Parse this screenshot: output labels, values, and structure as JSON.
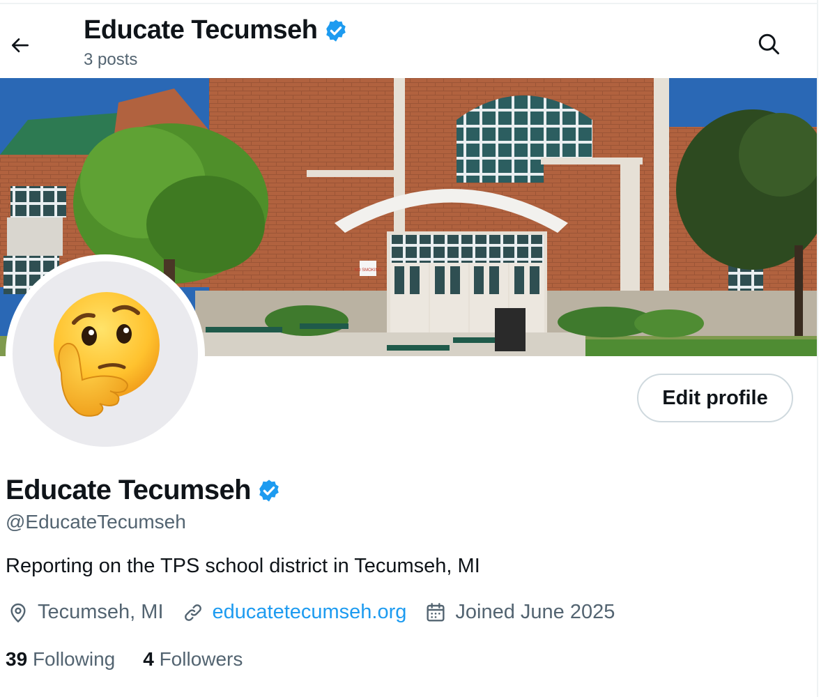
{
  "header": {
    "title": "Educate Tecumseh",
    "posts_count": "3 posts",
    "back_icon": "arrow-left-icon",
    "search_icon": "search-icon"
  },
  "profile": {
    "name": "Educate Tecumseh",
    "handle": "@EducateTecumseh",
    "bio": "Reporting on the TPS school district in Tecumseh, MI",
    "location": "Tecumseh, MI",
    "website": "educatetecumseh.org",
    "joined": "Joined June 2025",
    "following_count": "39",
    "following_label": "Following",
    "followers_count": "4",
    "followers_label": "Followers",
    "avatar_icon": "thinking-face-emoji",
    "verified_icon": "verified-badge-icon"
  },
  "actions": {
    "edit_profile_label": "Edit profile"
  },
  "banner": {
    "sign_text": "NO SMOKING"
  },
  "colors": {
    "accent": "#1d9bf0",
    "verified": "#1d9bf0",
    "text": "#0f1419",
    "secondary": "#536471",
    "border": "#cfd9de"
  }
}
